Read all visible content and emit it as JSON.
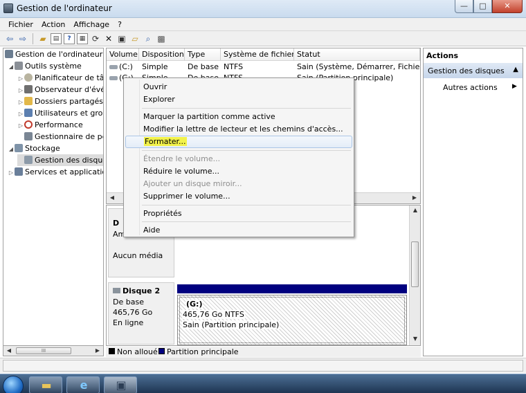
{
  "window": {
    "title": "Gestion de l'ordinateur",
    "buttons": {
      "minimize": "—",
      "maximize": "□",
      "close": "✕"
    }
  },
  "menu": {
    "items": [
      "Fichier",
      "Action",
      "Affichage",
      "?"
    ]
  },
  "toolbar": {
    "icons": [
      "back-arrow",
      "forward-arrow",
      "up-folder",
      "show-tree",
      "help",
      "console-tree",
      "refresh",
      "delete",
      "properties",
      "open",
      "search",
      "settings"
    ]
  },
  "tree": {
    "items": [
      {
        "label": "Gestion de l'ordinateur (l",
        "level": 0
      },
      {
        "label": "Outils système",
        "level": 1
      },
      {
        "label": "Planificateur de tâc",
        "level": 2
      },
      {
        "label": "Observateur d'évér",
        "level": 2
      },
      {
        "label": "Dossiers partagés",
        "level": 2
      },
      {
        "label": "Utilisateurs et grou",
        "level": 2
      },
      {
        "label": "Performance",
        "level": 2
      },
      {
        "label": "Gestionnaire de pé",
        "level": 2
      },
      {
        "label": "Stockage",
        "level": 1
      },
      {
        "label": "Gestion des disque",
        "level": 2
      },
      {
        "label": "Services et application",
        "level": 1
      }
    ],
    "scroll_thumb": "III"
  },
  "volume_list": {
    "columns": [
      "Volume",
      "Disposition",
      "Type",
      "Système de fichiers",
      "Statut"
    ],
    "rows": [
      {
        "volume": "(C:)",
        "disposition": "Simple",
        "type": "De base",
        "fs": "NTFS",
        "status": "Sain (Système, Démarrer, Fichier d'é"
      },
      {
        "volume": "(G:)",
        "disposition": "Simple",
        "type": "De base",
        "fs": "NTFS",
        "status": "Sain (Partition principale)"
      }
    ]
  },
  "disk_view": {
    "disk1": {
      "name": "D",
      "line2": "Am",
      "media": "Aucun média"
    },
    "disk2": {
      "name": "Disque 2",
      "type": "De base",
      "size": "465,76 Go",
      "state": "En ligne"
    },
    "partition": {
      "letter": "(G:)",
      "size": "465,76 Go NTFS",
      "status": "Sain (Partition principale)"
    }
  },
  "legend": {
    "unallocated": "Non alloué",
    "primary": "Partition principale",
    "colors": {
      "unallocated": "#000000",
      "primary": "#00007f"
    }
  },
  "actions": {
    "title": "Actions",
    "section": "Gestion des disques",
    "more": "Autres actions"
  },
  "context_menu": {
    "items": [
      {
        "label": "Ouvrir",
        "enabled": true
      },
      {
        "label": "Explorer",
        "enabled": true
      },
      {
        "label": "Marquer la partition comme active",
        "enabled": true
      },
      {
        "label": "Modifier la lettre de lecteur et les chemins d'accès...",
        "enabled": true
      },
      {
        "label": "Formater...",
        "enabled": true,
        "highlighted": true
      },
      {
        "label": "Étendre le volume...",
        "enabled": false
      },
      {
        "label": "Réduire le volume...",
        "enabled": true
      },
      {
        "label": "Ajouter un disque miroir...",
        "enabled": false
      },
      {
        "label": "Supprimer le volume...",
        "enabled": true
      },
      {
        "label": "Propriétés",
        "enabled": true
      },
      {
        "label": "Aide",
        "enabled": true
      }
    ]
  }
}
